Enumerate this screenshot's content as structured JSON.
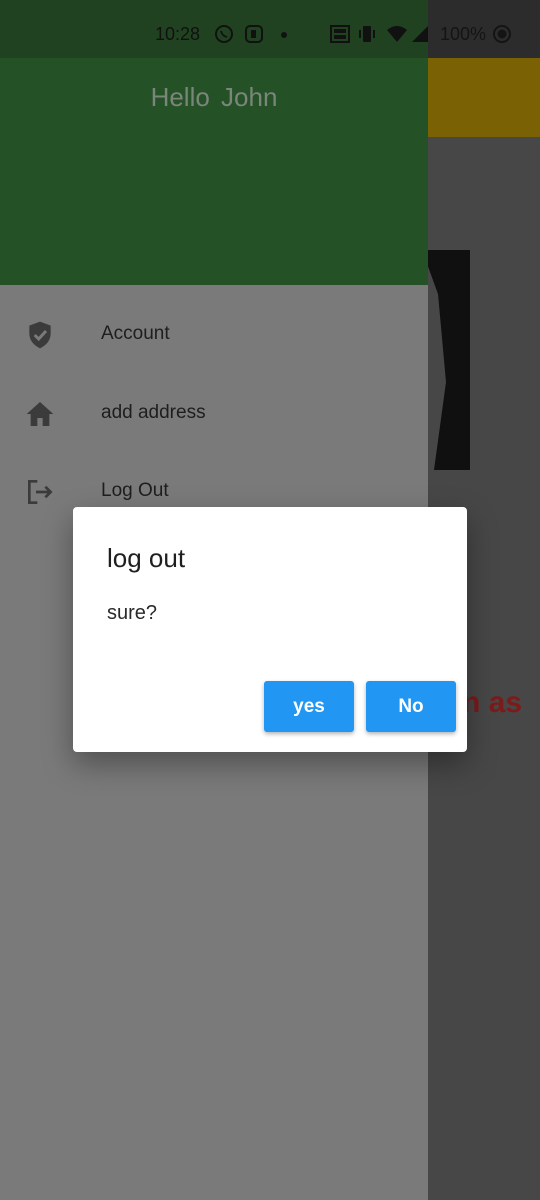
{
  "status_bar": {
    "time": "10:28",
    "battery": "100%",
    "icons": [
      "whatsapp-icon",
      "app-notification-icon",
      "dot-icon",
      "volte-icon",
      "vibrate-icon",
      "wifi-icon",
      "signal-icon",
      "battery-icon"
    ]
  },
  "drawer": {
    "greeting": "Hello  John",
    "header_color": "#255127",
    "items": [
      {
        "label": "Account",
        "icon": "shield-check-icon"
      },
      {
        "label": "add address",
        "icon": "home-icon"
      },
      {
        "label": "Log Out",
        "icon": "logout-icon"
      }
    ]
  },
  "background": {
    "partial_text": "n as",
    "appbar_color": "#7a6103"
  },
  "dialog": {
    "title": "log out",
    "message": "sure?",
    "yes_label": "yes",
    "no_label": "No",
    "button_color": "#2196f3"
  }
}
